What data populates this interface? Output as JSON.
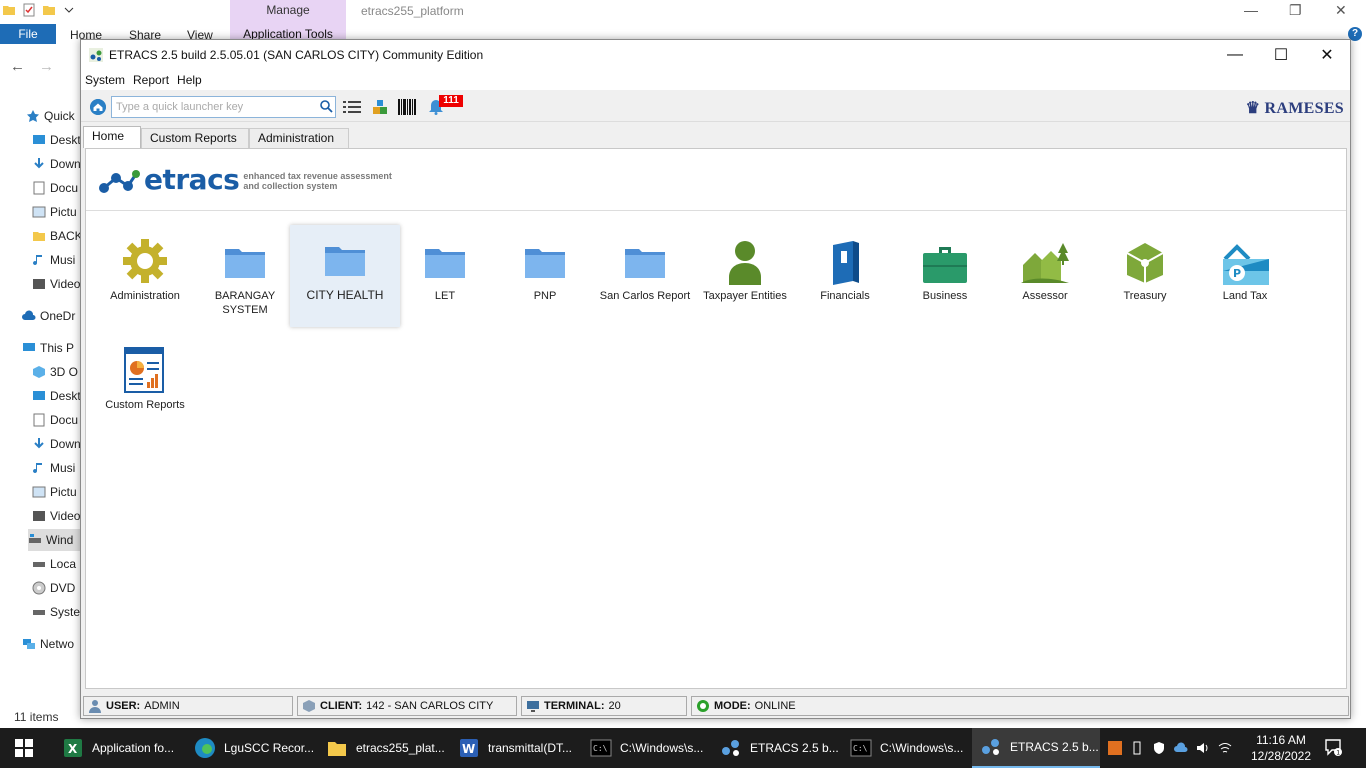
{
  "explorer": {
    "title": "etracs255_platform",
    "manage_tab": "Manage",
    "application_tools_tab": "Application Tools",
    "tabs": [
      "File",
      "Home",
      "Share",
      "View"
    ],
    "nav_items": [
      "Quick",
      "Deskt",
      "Down",
      "Docu",
      "Pictu",
      "BACK",
      "Musi",
      "Video",
      "OneDr",
      "This P",
      "3D O",
      "Deskt",
      "Docu",
      "Down",
      "Musi",
      "Pictu",
      "Video",
      "Wind",
      "Loca",
      "DVD",
      "Syste",
      "Netwo"
    ],
    "items_count": "11 items"
  },
  "etracs": {
    "window_title": "ETRACS 2.5 build 2.5.05.01 (SAN CARLOS CITY)  Community Edition",
    "menu": [
      "System",
      "Report",
      "Help"
    ],
    "search_placeholder": "Type a quick launcher key",
    "notification_count": "111",
    "vendor_logo": "RAMESES",
    "tabs": [
      "Home",
      "Custom Reports",
      "Administration"
    ],
    "logo_word": "etracs",
    "logo_tagline_1": "enhanced tax revenue assessment",
    "logo_tagline_2": "and collection system",
    "tiles": [
      {
        "label": "Administration",
        "icon": "gear-icon"
      },
      {
        "label": "BARANGAY SYSTEM",
        "icon": "folder-icon"
      },
      {
        "label": "CITY HEALTH",
        "icon": "folder-icon"
      },
      {
        "label": "LET",
        "icon": "folder-icon"
      },
      {
        "label": "PNP",
        "icon": "folder-icon"
      },
      {
        "label": "San Carlos Report",
        "icon": "folder-icon"
      },
      {
        "label": "Taxpayer Entities",
        "icon": "person-icon"
      },
      {
        "label": "Financials",
        "icon": "binder-icon"
      },
      {
        "label": "Business",
        "icon": "briefcase-icon"
      },
      {
        "label": "Assessor",
        "icon": "houses-icon"
      },
      {
        "label": "Treasury",
        "icon": "treasury-icon"
      },
      {
        "label": "Land Tax",
        "icon": "land-tax-icon"
      },
      {
        "label": "Custom Reports",
        "icon": "report-icon"
      }
    ],
    "status": {
      "user_key": "USER:",
      "user_val": "ADMIN",
      "client_key": "CLIENT:",
      "client_val": "142 - SAN CARLOS CITY",
      "terminal_key": "TERMINAL:",
      "terminal_val": "20",
      "mode_key": "MODE:",
      "mode_val": "ONLINE"
    }
  },
  "taskbar": {
    "items": [
      {
        "label": "Application fo...",
        "icon": "excel-icon"
      },
      {
        "label": "LguSCC Recor...",
        "icon": "edge-icon"
      },
      {
        "label": "etracs255_plat...",
        "icon": "folder-icon"
      },
      {
        "label": "transmittal(DT...",
        "icon": "word-icon"
      },
      {
        "label": "C:\\Windows\\s...",
        "icon": "cmd-icon"
      },
      {
        "label": "ETRACS 2.5 b...",
        "icon": "etracs-icon"
      },
      {
        "label": "C:\\Windows\\s...",
        "icon": "cmd-icon"
      },
      {
        "label": "ETRACS 2.5 b...",
        "icon": "etracs-icon"
      }
    ],
    "time": "11:16 AM",
    "date": "12/28/2022",
    "notification_count": "1"
  }
}
